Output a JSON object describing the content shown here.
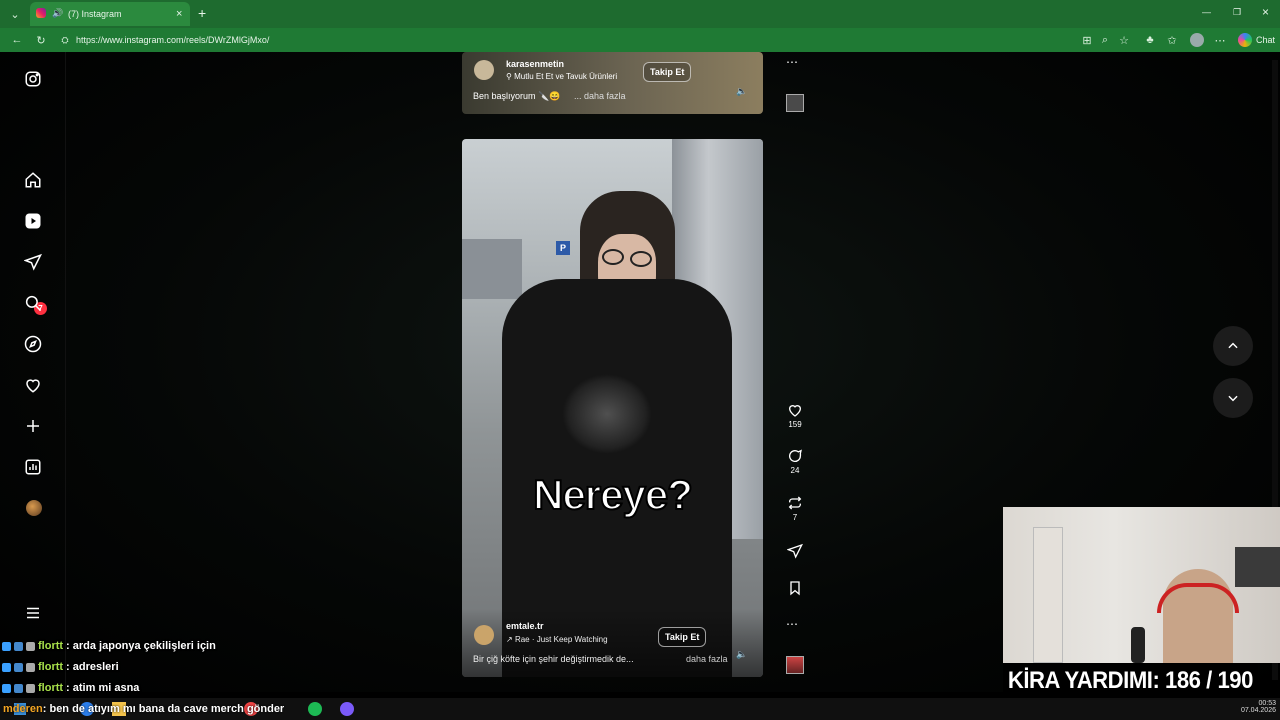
{
  "browser": {
    "tab_title": "(7) Instagram",
    "url": "https://www.instagram.com/reels/DWrZMlGjMxo/",
    "chat_label": "Chat"
  },
  "sidebar": {
    "notification_count": "7"
  },
  "reel_top": {
    "username": "karasenmetin",
    "location": "Mutlu Et Et ve Tavuk Ürünleri",
    "follow_label": "Takip Et",
    "caption": "Ben başlıyorum 🔪😄",
    "more_label": "... daha fazla"
  },
  "reel_main": {
    "overlay_text": "Nereye?",
    "username": "emtale.tr",
    "audio": "Rae · Just Keep Watching",
    "follow_label": "Takip Et",
    "caption": "Bir çiğ köfte için şehir değiştirmedik de...",
    "more_label": "daha fazla",
    "likes": "159",
    "comments": "24",
    "reposts": "7"
  },
  "stream": {
    "goal_text": "KİRA YARDIMI:  186 / 190",
    "chat": [
      {
        "user": "flortt",
        "message": ": arda japonya çekilişleri için"
      },
      {
        "user": "flortt",
        "message": ": adresleri"
      },
      {
        "user": "flortt",
        "message": ": atim mi asna"
      },
      {
        "user": "mderen",
        "message": ": ben de atıyım mı bana da cave merch gönder"
      }
    ]
  },
  "taskbar": {
    "time": "00:53",
    "date": "07.04.2026"
  },
  "colors": {
    "browser_green": "#1f7a34",
    "notification_red": "#ff3040"
  }
}
